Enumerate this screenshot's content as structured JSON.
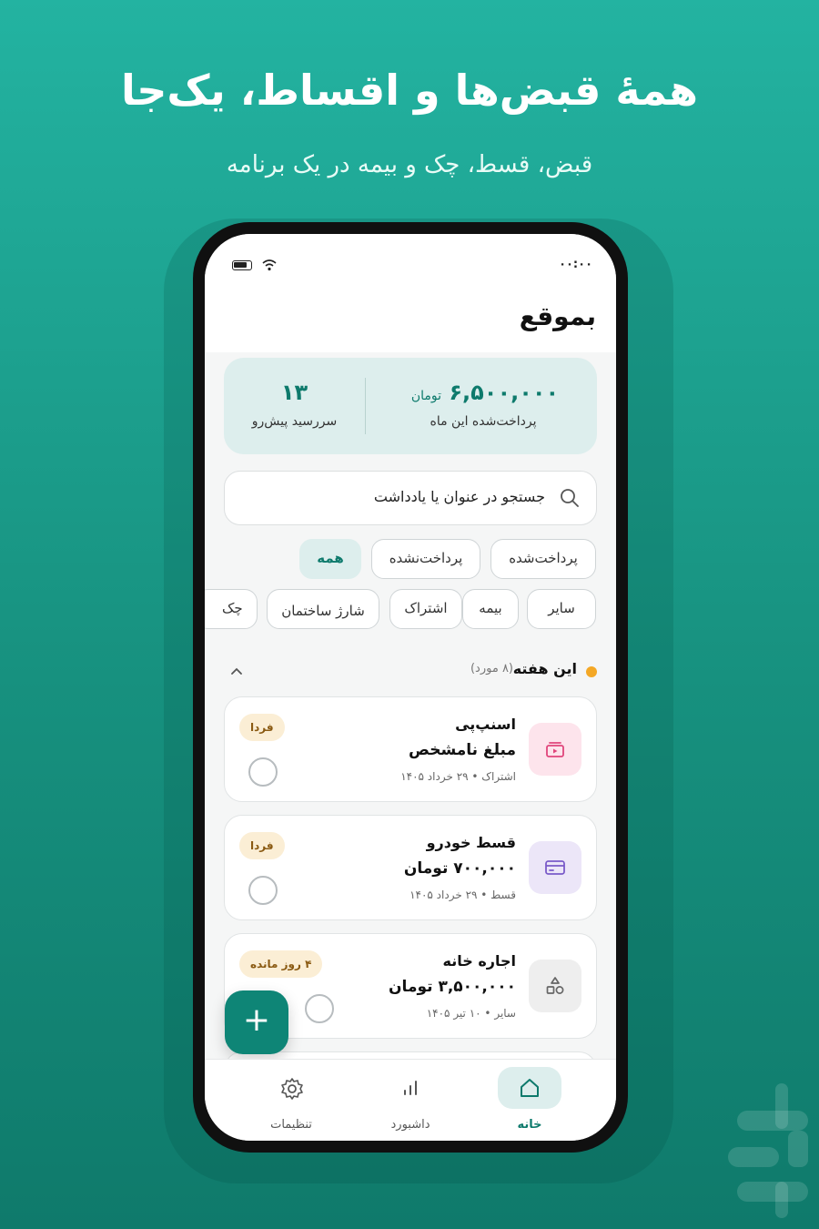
{
  "hero": {
    "title": "همهٔ قبض‌ها و اقساط، یک‌جا",
    "subtitle": "قبض، قسط، چک و بیمه در یک برنامه"
  },
  "status_bar": {
    "time": "۰۰:۰۰"
  },
  "app": {
    "title": "بموقع"
  },
  "summary": {
    "paid_value": "۶,۵۰۰,۰۰۰",
    "paid_unit": "تومان",
    "paid_label": "پرداخت‌شده این ماه",
    "upcoming_value": "۱۳",
    "upcoming_label": "سررسید پیش‌رو"
  },
  "search": {
    "placeholder": "جستجو در عنوان یا یادداشت"
  },
  "status_filters": [
    {
      "label": "پرداخت‌شده",
      "selected": false
    },
    {
      "label": "پرداخت‌نشده",
      "selected": false
    },
    {
      "label": "همه",
      "selected": true
    }
  ],
  "category_filters": [
    "سایر",
    "بیمه",
    "اشتراک",
    "شارژ ساختمان",
    "چک"
  ],
  "section": {
    "title": "این هفته",
    "count": "(۸ مورد)"
  },
  "items": [
    {
      "title": "اسنپ‌پی",
      "amount": "مبلغ نامشخص",
      "meta": "اشتراک • ۲۹ خرداد ۱۴۰۵",
      "badge": "فردا",
      "icon": "subscription-icon",
      "icon_color": "#e0457b",
      "icon_bg": "#fde4ec"
    },
    {
      "title": "قسط خودرو",
      "amount": "۷۰۰,۰۰۰ تومان",
      "meta": "قسط • ۲۹ خرداد ۱۴۰۵",
      "badge": "فردا",
      "icon": "card-icon",
      "icon_color": "#7a5bc9",
      "icon_bg": "#ece6f8"
    },
    {
      "title": "اجاره خانه",
      "amount": "۳,۵۰۰,۰۰۰ تومان",
      "meta": "سایر • ۱۰ تیر ۱۴۰۵",
      "badge": "۴ روز مانده",
      "icon": "shapes-icon",
      "icon_color": "#666666",
      "icon_bg": "#eeeeee"
    }
  ],
  "nav": [
    {
      "label": "خانه",
      "icon": "home-icon",
      "active": true
    },
    {
      "label": "داشبورد",
      "icon": "chart-icon",
      "active": false
    },
    {
      "label": "تنظیمات",
      "icon": "gear-icon",
      "active": false
    }
  ],
  "colors": {
    "brand": "#0e8576",
    "brand_soft": "#ddeeed",
    "badge_bg": "#fbeed5",
    "section_dot": "#f4a826"
  }
}
